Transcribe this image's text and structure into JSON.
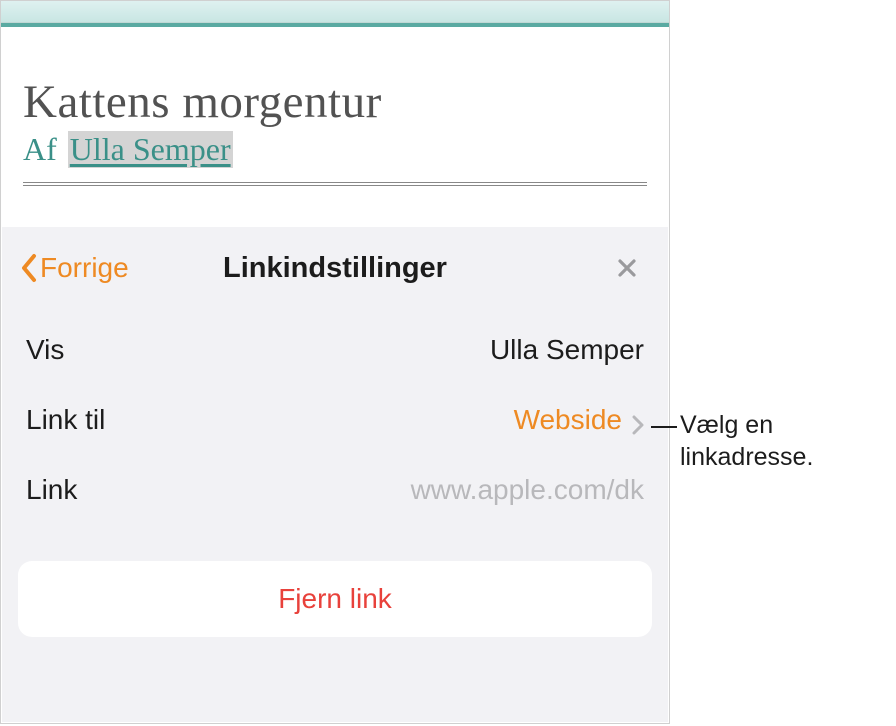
{
  "document": {
    "title": "Kattens morgentur",
    "subtitle_prefix": "Af",
    "subtitle_linked": "Ulla Semper"
  },
  "popover": {
    "back_label": "Forrige",
    "title": "Linkindstillinger",
    "rows": {
      "display": {
        "label": "Vis",
        "value": "Ulla Semper"
      },
      "link_to": {
        "label": "Link til",
        "value": "Webside"
      },
      "link": {
        "label": "Link",
        "placeholder": "www.apple.com/dk"
      }
    },
    "remove_label": "Fjern link"
  },
  "callout": {
    "text": "Vælg en linkadresse."
  }
}
